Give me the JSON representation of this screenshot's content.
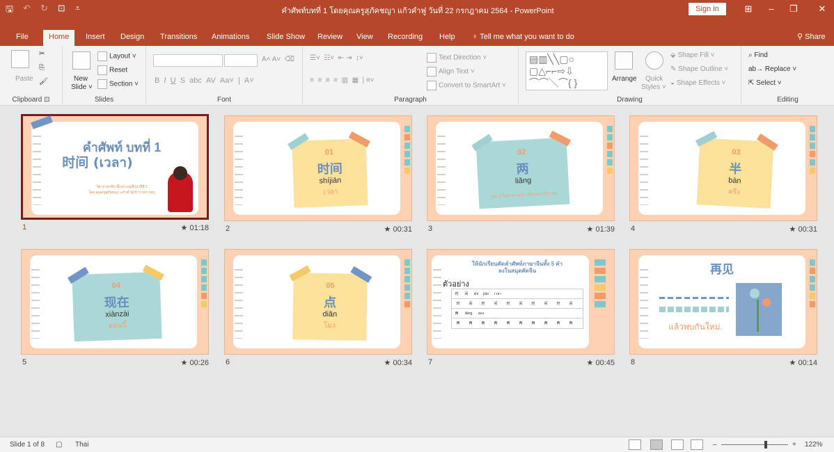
{
  "titlebar": {
    "title": "คำศัพท์บทที่ 1 โดยคุณครูสุภัคชญา แก้วคำฟู วันที่ 22 กรกฎาคม 2564 - PowerPoint",
    "sign_in": "Sign in",
    "quick_access": [
      "save-icon",
      "undo-icon",
      "redo-icon",
      "present-icon",
      "customize-icon"
    ]
  },
  "tabs": [
    "File",
    "Home",
    "Insert",
    "Design",
    "Transitions",
    "Animations",
    "Slide Show",
    "Review",
    "View",
    "Recording",
    "Help"
  ],
  "active_tab": "Home",
  "tell_me": "Tell me what you want to do",
  "share": "Share",
  "ribbon": {
    "clipboard": {
      "paste": "Paste",
      "label": "Clipboard"
    },
    "slides": {
      "new_slide": "New",
      "new_slide2": "Slide ˅",
      "layout": "Layout ˅",
      "reset": "Reset",
      "section": "Section ˅",
      "label": "Slides"
    },
    "font": {
      "label": "Font"
    },
    "paragraph": {
      "text_direction": "Text Direction ˅",
      "align_text": "Align Text ˅",
      "convert": "Convert to SmartArt ˅",
      "label": "Paragraph"
    },
    "drawing": {
      "arrange": "Arrange",
      "quick_styles": "Quick",
      "quick_styles2": "Styles ˅",
      "shape_fill": "Shape Fill ˅",
      "shape_outline": "Shape Outline ˅",
      "shape_effects": "Shape Effects ˅",
      "label": "Drawing"
    },
    "editing": {
      "find": "Find",
      "replace": "Replace ˅",
      "select": "Select ˅",
      "label": "Editing"
    }
  },
  "slides": [
    {
      "number": "1",
      "time": "★ 01:18",
      "title": "คำศัพท์ บทที่ 1",
      "zh": "时间 (เวลา)",
      "line1": "วิชาภาษาจีน ชั้นประถมศึกษาปีที่ 2",
      "line2": "โดย คุณครูสุภัคชญา แก้วคำฟู  ข้าราชการครู"
    },
    {
      "number": "2",
      "time": "★ 00:31",
      "num": "01",
      "zh": "时间",
      "pinyin": "shíjiān",
      "thai": "เวลา"
    },
    {
      "number": "3",
      "time": "★ 01:39",
      "num": "02",
      "zh": "两",
      "pinyin": "liǎng",
      "thai": "สอง (เป็นจำนวนนับ หรือบอกปริมาณ)"
    },
    {
      "number": "4",
      "time": "★ 00:31",
      "num": "03",
      "zh": "半",
      "pinyin": "bàn",
      "thai": "ครึ่ง"
    },
    {
      "number": "5",
      "time": "★ 00:26",
      "num": "04",
      "zh": "现在",
      "pinyin": "xiànzài",
      "thai": "ตอนนี้"
    },
    {
      "number": "6",
      "time": "★ 00:34",
      "num": "05",
      "zh": "点",
      "pinyin": "diǎn",
      "thai": "โมง"
    },
    {
      "number": "7",
      "time": "★ 00:45",
      "title": "ให้นักเรียนคัดคำศัพท์ภาษาจีนทั้ง 5 คำ",
      "title2": "ลงในสมุดคัดจีน",
      "example": "ตัวอย่าง",
      "row1": [
        "时",
        "间",
        "shí",
        "jiān",
        "เวลา"
      ],
      "row2": [
        "时",
        "间",
        "时",
        "间",
        "时",
        "间",
        "时",
        "间",
        "时",
        "间"
      ],
      "row3": [
        "两",
        "liǎng",
        "สอง"
      ],
      "row4": [
        "两",
        "两",
        "两",
        "两",
        "两",
        "两",
        "两",
        "两",
        "两",
        "两"
      ]
    },
    {
      "number": "8",
      "time": "★ 00:14",
      "zh": "再见",
      "thai": "แล้วพบกันใหม่."
    }
  ],
  "status": {
    "slide_of": "Slide 1 of 8",
    "language": "Thai",
    "zoom": "122%"
  }
}
